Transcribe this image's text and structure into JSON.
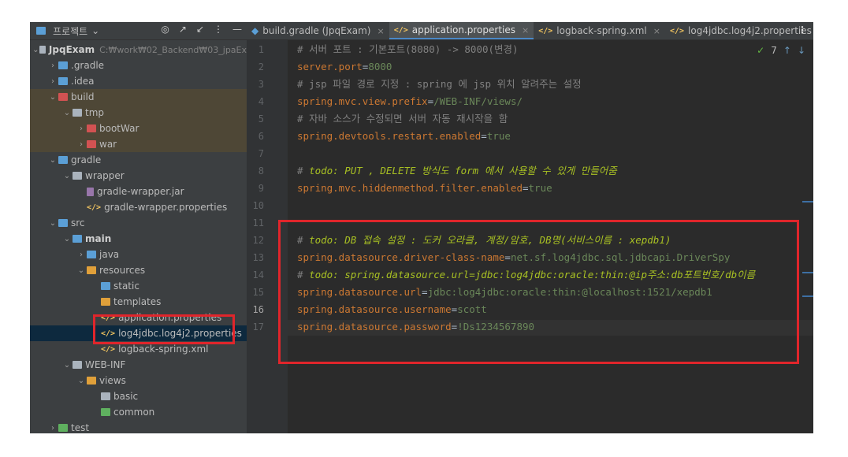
{
  "project_panel": {
    "title": "프로젝트",
    "title_arrow": "⌄",
    "tools": [
      "◎",
      "↗",
      "↙",
      "⋮",
      "—"
    ],
    "tree": [
      {
        "label": "JpqExam",
        "sub": "C:₩work₩02_Backend₩03_jpaEx",
        "arrow": "⌄",
        "icon": "folder-icon"
      },
      {
        "label": ".gradle",
        "arrow": "›",
        "icon": "folder-icon"
      },
      {
        "label": ".idea",
        "arrow": "›",
        "icon": "folder-icon"
      },
      {
        "label": "build",
        "arrow": "⌄",
        "icon": "folder-icon"
      },
      {
        "label": "tmp",
        "arrow": "⌄",
        "icon": "folder-icon"
      },
      {
        "label": "bootWar",
        "arrow": "›",
        "icon": "folder-icon"
      },
      {
        "label": "war",
        "arrow": "›",
        "icon": "folder-icon"
      },
      {
        "label": "gradle",
        "arrow": "⌄",
        "icon": "folder-icon"
      },
      {
        "label": "wrapper",
        "arrow": "⌄",
        "icon": "folder-icon"
      },
      {
        "label": "gradle-wrapper.jar",
        "arrow": "",
        "icon": "jar-icon"
      },
      {
        "label": "gradle-wrapper.properties",
        "arrow": "",
        "icon": "properties-icon"
      },
      {
        "label": "src",
        "arrow": "⌄",
        "icon": "folder-icon"
      },
      {
        "label": "main",
        "arrow": "⌄",
        "icon": "folder-icon"
      },
      {
        "label": "java",
        "arrow": "›",
        "icon": "folder-icon"
      },
      {
        "label": "resources",
        "arrow": "⌄",
        "icon": "folder-icon"
      },
      {
        "label": "static",
        "arrow": "",
        "icon": "folder-icon"
      },
      {
        "label": "templates",
        "arrow": "",
        "icon": "folder-icon"
      },
      {
        "label": "application.properties",
        "arrow": "",
        "icon": "properties-icon"
      },
      {
        "label": "log4jdbc.log4j2.properties",
        "arrow": "",
        "icon": "properties-icon"
      },
      {
        "label": "logback-spring.xml",
        "arrow": "",
        "icon": "xml-icon"
      },
      {
        "label": "WEB-INF",
        "arrow": "⌄",
        "icon": "folder-icon"
      },
      {
        "label": "views",
        "arrow": "⌄",
        "icon": "folder-icon"
      },
      {
        "label": "basic",
        "arrow": "",
        "icon": "folder-icon"
      },
      {
        "label": "common",
        "arrow": "",
        "icon": "folder-icon"
      },
      {
        "label": "test",
        "arrow": "›",
        "icon": "folder-icon"
      }
    ]
  },
  "tabs": [
    {
      "label": "build.gradle (JpqExam)",
      "close": "×",
      "icon": "gradle-icon"
    },
    {
      "label": "application.properties",
      "close": "×",
      "icon": "properties-icon",
      "active": true
    },
    {
      "label": "logback-spring.xml",
      "close": "×",
      "icon": "xml-icon"
    },
    {
      "label": "log4jdbc.log4j2.properties",
      "close": "×",
      "icon": "properties-icon"
    }
  ],
  "tabs_more": "⋮",
  "inspection": {
    "count": "7",
    "ok_mark": "✓",
    "up": "↑",
    "down": "↓"
  },
  "editor": {
    "line_numbers": [
      "1",
      "2",
      "3",
      "4",
      "5",
      "6",
      "7",
      "8",
      "9",
      "10",
      "11",
      "12",
      "13",
      "14",
      "15",
      "16",
      "17"
    ],
    "current_line": "16",
    "lines": [
      {
        "segments": [
          {
            "t": "# 서버 포트 : 기본포트(8080) -> 8000(변경)",
            "c": "comment"
          }
        ]
      },
      {
        "segments": [
          {
            "t": "server.port",
            "c": "key"
          },
          {
            "t": "=",
            "c": "val2"
          },
          {
            "t": "8000",
            "c": "val"
          }
        ]
      },
      {
        "segments": [
          {
            "t": "# jsp 파일 경로 지정 : spring 에 jsp 위치 알려주는 설정",
            "c": "comment"
          }
        ]
      },
      {
        "segments": [
          {
            "t": "spring.mvc.view.prefix",
            "c": "key"
          },
          {
            "t": "=",
            "c": "val2"
          },
          {
            "t": "/WEB-INF/views/",
            "c": "val"
          }
        ]
      },
      {
        "segments": [
          {
            "t": "# 자바 소스가 수정되면 서버 자동 재시작을 함",
            "c": "comment"
          }
        ]
      },
      {
        "segments": [
          {
            "t": "spring.devtools.restart.enabled",
            "c": "key"
          },
          {
            "t": "=",
            "c": "val2"
          },
          {
            "t": "true",
            "c": "val"
          }
        ]
      },
      {
        "segments": []
      },
      {
        "segments": [
          {
            "t": "# ",
            "c": "comment"
          },
          {
            "t": "todo: PUT , DELETE 방식도 form 에서 사용할 수 있게 만들어줌",
            "c": "todo"
          }
        ]
      },
      {
        "segments": [
          {
            "t": "spring.mvc.hiddenmethod.filter.enabled",
            "c": "key"
          },
          {
            "t": "=",
            "c": "val2"
          },
          {
            "t": "true",
            "c": "val"
          }
        ]
      },
      {
        "segments": []
      },
      {
        "segments": []
      },
      {
        "segments": [
          {
            "t": "# ",
            "c": "comment"
          },
          {
            "t": "todo: DB 접속 설정 : 도커 오라클, 계정/암호, DB명(서비스이름 : xepdb1)",
            "c": "todo"
          }
        ]
      },
      {
        "segments": [
          {
            "t": "spring.datasource.driver-class-name",
            "c": "key"
          },
          {
            "t": "=",
            "c": "val2"
          },
          {
            "t": "net.sf.log4jdbc.sql.jdbcapi.DriverSpy",
            "c": "val"
          }
        ]
      },
      {
        "segments": [
          {
            "t": "# ",
            "c": "comment"
          },
          {
            "t": "todo: spring.datasource.url=jdbc:log4jdbc:oracle:thin:@ip주소:db포트번호/db이름",
            "c": "todo"
          }
        ]
      },
      {
        "segments": [
          {
            "t": "spring.datasource.url",
            "c": "key"
          },
          {
            "t": "=",
            "c": "val2"
          },
          {
            "t": "jdbc:log4jdbc:oracle:thin:@localhost:1521/xepdb1",
            "c": "val"
          }
        ]
      },
      {
        "segments": [
          {
            "t": "spring.datasource.username",
            "c": "key"
          },
          {
            "t": "=",
            "c": "val2"
          },
          {
            "t": "scott",
            "c": "val"
          }
        ]
      },
      {
        "segments": [
          {
            "t": "spring.datasource.password",
            "c": "key"
          },
          {
            "t": "=",
            "c": "val2"
          },
          {
            "t": "!Ds1234567890",
            "c": "val"
          }
        ]
      }
    ]
  },
  "colors": {
    "annotation_box": "#e0252b",
    "selection": "#0d293e",
    "excluded_folder": "#4e4736"
  }
}
